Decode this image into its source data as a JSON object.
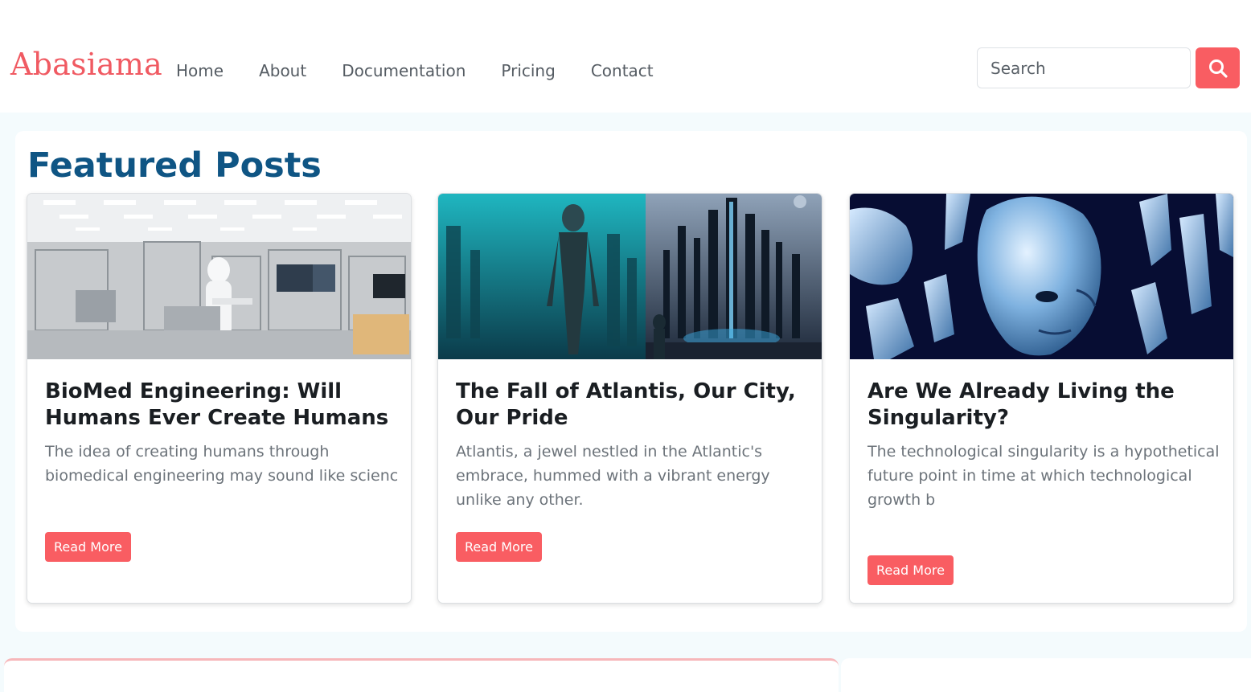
{
  "brand": "Abasiama",
  "nav": {
    "links": [
      "Home",
      "About",
      "Documentation",
      "Pricing",
      "Contact"
    ]
  },
  "search": {
    "placeholder": "Search",
    "icon": "search-icon"
  },
  "featured": {
    "title": "Featured Posts",
    "posts": [
      {
        "title": "BioMed Engineering: Will Humans Ever Create Humans",
        "excerpt": "The idea of creating humans through biomedical engineering may sound like scienc",
        "button": "Read More"
      },
      {
        "title": "The Fall of Atlantis, Our City, Our Pride",
        "excerpt": "Atlantis, a jewel nestled in the Atlantic's embrace, hummed with a vibrant energy unlike any other.",
        "button": "Read More"
      },
      {
        "title": "Are We Already Living the Singularity?",
        "excerpt": "The technological singularity is a hypothetical future point in time at which technological growth b",
        "button": "Read More"
      }
    ]
  },
  "colors": {
    "brand": "#f05a62",
    "accent": "#f95d62",
    "heading": "#0f5584",
    "page_bg": "#f4fbfd"
  }
}
